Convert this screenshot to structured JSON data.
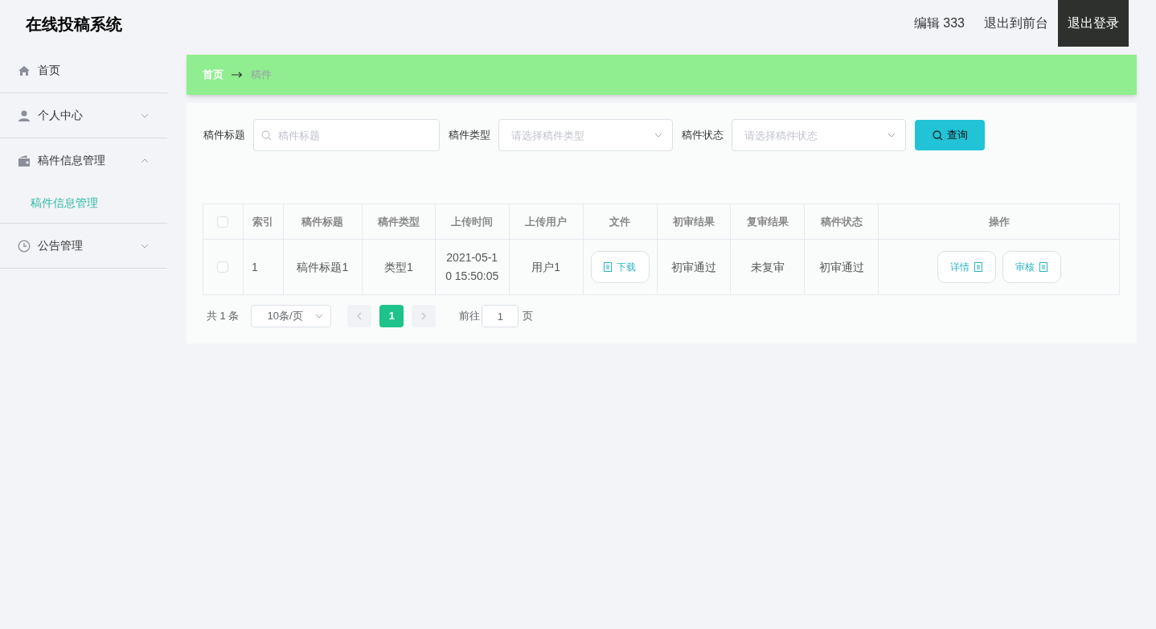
{
  "header": {
    "title": "在线投稿系统",
    "links": [
      {
        "label": "编辑 333",
        "selected": false
      },
      {
        "label": "退出到前台",
        "selected": false
      },
      {
        "label": "退出登录",
        "selected": true
      }
    ]
  },
  "sidebar": {
    "items": [
      {
        "label": "首页",
        "kind": "home"
      },
      {
        "label": "个人中心",
        "kind": "user",
        "expanded": false
      },
      {
        "label": "稿件信息管理",
        "kind": "wallet",
        "expanded": true,
        "children": [
          {
            "label": "稿件信息管理",
            "selected": true
          }
        ]
      },
      {
        "label": "公告管理",
        "kind": "clock",
        "expanded": false
      }
    ]
  },
  "breadcrumb": [
    "首页",
    "稿件"
  ],
  "filters": [
    {
      "label": "稿件标题",
      "kind": "search",
      "placeholder": "稿件标题"
    },
    {
      "label": "稿件类型",
      "kind": "select",
      "placeholder": "请选择稿件类型"
    },
    {
      "label": "稿件状态",
      "kind": "select",
      "placeholder": "请选择稿件状态"
    }
  ],
  "search_button": "查询",
  "table": {
    "all_checked": false,
    "columns": [
      "索引",
      "稿件标题",
      "稿件类型",
      "上传时间",
      "上传用户",
      "文件",
      "初审结果",
      "复审结果",
      "稿件状态",
      "操作"
    ],
    "rows": [
      {
        "checked": false,
        "index": "1",
        "title": "稿件标题1",
        "type": "类型1",
        "time": "2021-05-10 15:50:05",
        "user": "用户1",
        "file_button": "下载",
        "first_review": "初审通过",
        "second_review": "未复审",
        "status": "初审通过",
        "actions": [
          "详情",
          "审核"
        ]
      }
    ]
  },
  "pagination": {
    "total": "共 1 条",
    "page_size": "10条/页",
    "pages": [
      {
        "label": "1",
        "selected": true
      }
    ],
    "goto_label": "前往",
    "goto_value": "1",
    "page_suffix": "页"
  }
}
